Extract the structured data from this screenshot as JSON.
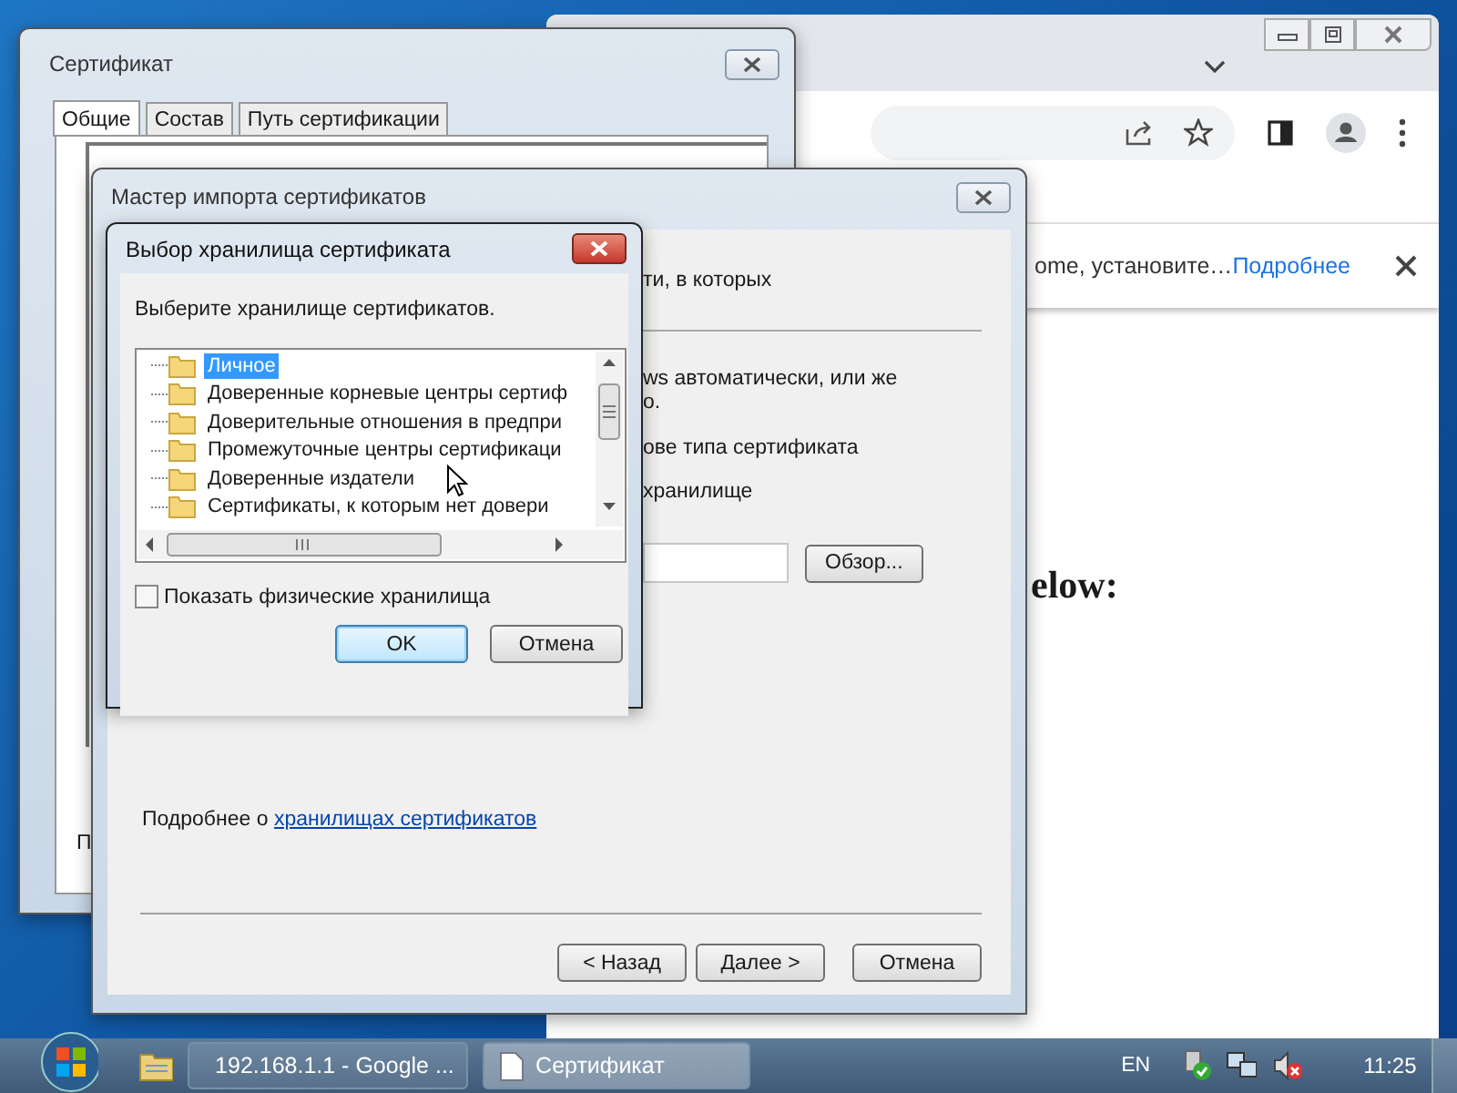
{
  "browser": {
    "infobar": {
      "text": "ome, установите…",
      "link": "Подробнее"
    },
    "page": {
      "heading": "elow:"
    }
  },
  "certificate_window": {
    "title": "Сертификат",
    "tabs": [
      {
        "label": "Общие",
        "selected": true
      },
      {
        "label": "Состав",
        "selected": false
      },
      {
        "label": "Путь сертификации",
        "selected": false
      }
    ],
    "partial_text": "П"
  },
  "import_wizard": {
    "title": "Мастер импорта сертификатов",
    "header_text": "ти, в которых",
    "body_lines": [
      "ws автоматически, или же",
      "о.",
      "ове типа сертификата",
      "хранилище"
    ],
    "browse_button": "Обзор...",
    "link_prefix": "Подробнее о",
    "link": "хранилищах сертификатов",
    "buttons": [
      {
        "label": "< Назад"
      },
      {
        "label": "Далее >"
      },
      {
        "label": "Отмена"
      }
    ]
  },
  "store_dialog": {
    "title": "Выбор хранилища сертификата",
    "prompt": "Выберите хранилище сертификатов.",
    "stores": [
      {
        "label": "Личное",
        "selected": true
      },
      {
        "label": "Доверенные корневые центры сертиф",
        "selected": false
      },
      {
        "label": "Доверительные отношения в предпри",
        "selected": false
      },
      {
        "label": "Промежуточные центры сертификаци",
        "selected": false
      },
      {
        "label": "Доверенные издатели",
        "selected": false
      },
      {
        "label": "Сертификаты, к которым нет довери",
        "selected": false
      }
    ],
    "show_physical": {
      "label": "Показать физические хранилища",
      "checked": false
    },
    "buttons": [
      {
        "label": "OK",
        "default": true
      },
      {
        "label": "Отмена",
        "default": false
      }
    ]
  },
  "taskbar": {
    "tasks": [
      {
        "label": "192.168.1.1 - Google ...",
        "kind": "browser",
        "selected": false
      },
      {
        "label": "Сертификат",
        "kind": "document",
        "selected": true
      }
    ],
    "language": "EN",
    "time": "11:25"
  }
}
